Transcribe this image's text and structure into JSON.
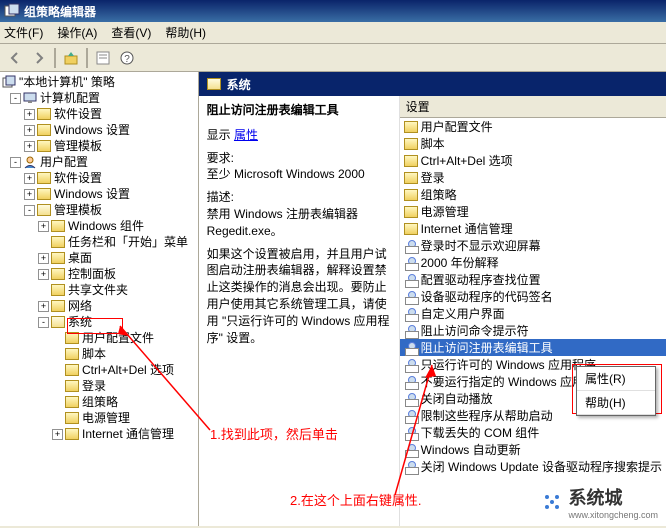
{
  "window": {
    "title": "组策略编辑器"
  },
  "menu": {
    "file": "文件(F)",
    "action": "操作(A)",
    "view": "查看(V)",
    "help": "帮助(H)"
  },
  "tree": {
    "root": "\"本地计算机\" 策略",
    "computer": "计算机配置",
    "user": "用户配置",
    "soft": "软件设置",
    "win": "Windows 设置",
    "admin": "管理模板",
    "wincomp": "Windows 组件",
    "taskbar": "任务栏和「开始」菜单",
    "desktop": "桌面",
    "cpanel": "控制面板",
    "shared": "共享文件夹",
    "network": "网络",
    "system": "系统",
    "userprof": "用户配置文件",
    "script": "脚本",
    "cad": "Ctrl+Alt+Del 选项",
    "logon": "登录",
    "gpolicy": "组策略",
    "power": "电源管理",
    "inet": "Internet 通信管理"
  },
  "header": {
    "title": "系统"
  },
  "detail": {
    "title": "阻止访问注册表编辑工具",
    "display": "显示",
    "properties": "属性",
    "require_label": "要求:",
    "require_val": "至少 Microsoft Windows 2000",
    "desc_label": "描述:",
    "desc1": "禁用 Windows 注册表编辑器 Regedit.exe。",
    "desc2": "如果这个设置被启用，并且用户试图启动注册表编辑器，解释设置禁止这类操作的消息会出现。要防止用户使用其它系统管理工具，请使用 \"只运行许可的 Windows 应用程序\" 设置。"
  },
  "list": {
    "header": "设置",
    "items": [
      "用户配置文件",
      "脚本",
      "Ctrl+Alt+Del 选项",
      "登录",
      "组策略",
      "电源管理",
      "Internet 通信管理",
      "登录时不显示欢迎屏幕",
      "2000 年份解释",
      "配置驱动程序查找位置",
      "设备驱动程序的代码签名",
      "自定义用户界面",
      "阻止访问命令提示符",
      "阻止访问注册表编辑工具",
      "只运行许可的 Windows 应用程序",
      "不要运行指定的 Windows 应用程序",
      "关闭自动播放",
      "限制这些程序从帮助启动",
      "下载丢失的 COM 组件",
      "Windows 自动更新",
      "关闭 Windows Update 设备驱动程序搜索提示"
    ],
    "folder_count": 7,
    "selected_index": 13
  },
  "context": {
    "properties": "属性(R)",
    "help": "帮助(H)"
  },
  "annotations": {
    "a1": "1.找到此项，然后单击",
    "a2": "2.在这个上面右键属性."
  },
  "watermark": {
    "main": "系统城",
    "sub": "www.xitongcheng.com"
  }
}
